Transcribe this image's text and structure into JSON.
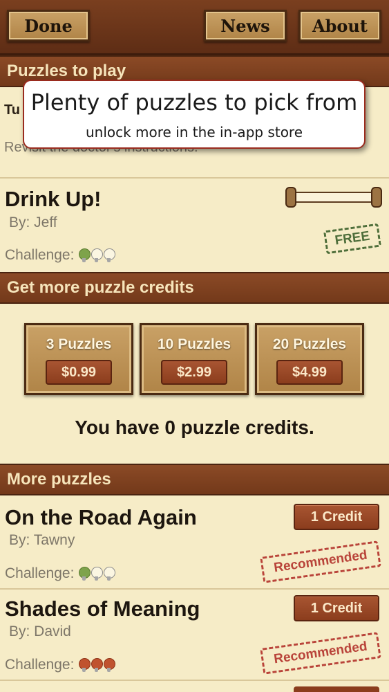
{
  "toolbar": {
    "done": "Done",
    "news": "News",
    "about": "About"
  },
  "callout": {
    "title": "Plenty of puzzles to pick from",
    "subtitle": "unlock more in the in-app store"
  },
  "sections": {
    "to_play": "Puzzles to play",
    "credits": "Get more puzzle credits",
    "more": "More puzzles"
  },
  "partial_row": {
    "title_fragment": "Tu",
    "desc_fragment": "Revisit the doctor's instructions."
  },
  "drink_up": {
    "title": "Drink Up!",
    "author": "By: Jeff",
    "challenge_label": "Challenge:",
    "challenge_level": "1 of 3",
    "stamp": "FREE",
    "progress": 0
  },
  "credit_packs": [
    {
      "label": "3 Puzzles",
      "price": "$0.99"
    },
    {
      "label": "10 Puzzles",
      "price": "$2.99"
    },
    {
      "label": "20 Puzzles",
      "price": "$4.99"
    }
  ],
  "credits_status": "You have 0 puzzle credits.",
  "more_puzzles": [
    {
      "title": "On the Road Again",
      "author": "By: Tawny",
      "challenge_label": "Challenge:",
      "challenge_level": "1 of 3",
      "price": "1 Credit",
      "stamp": "Recommended"
    },
    {
      "title": "Shades of Meaning",
      "author": "By: David",
      "challenge_label": "Challenge:",
      "challenge_level": "3 of 3",
      "price": "1 Credit",
      "stamp": "Recommended"
    }
  ],
  "colors": {
    "header": "#7a3f1f",
    "paper": "#f6ecc7",
    "button_red": "#8b3d1d",
    "stamp_red": "#b9443a",
    "stamp_green": "#4e6e3a",
    "bulb_green": "#7ea34b",
    "bulb_red": "#c0532e"
  }
}
